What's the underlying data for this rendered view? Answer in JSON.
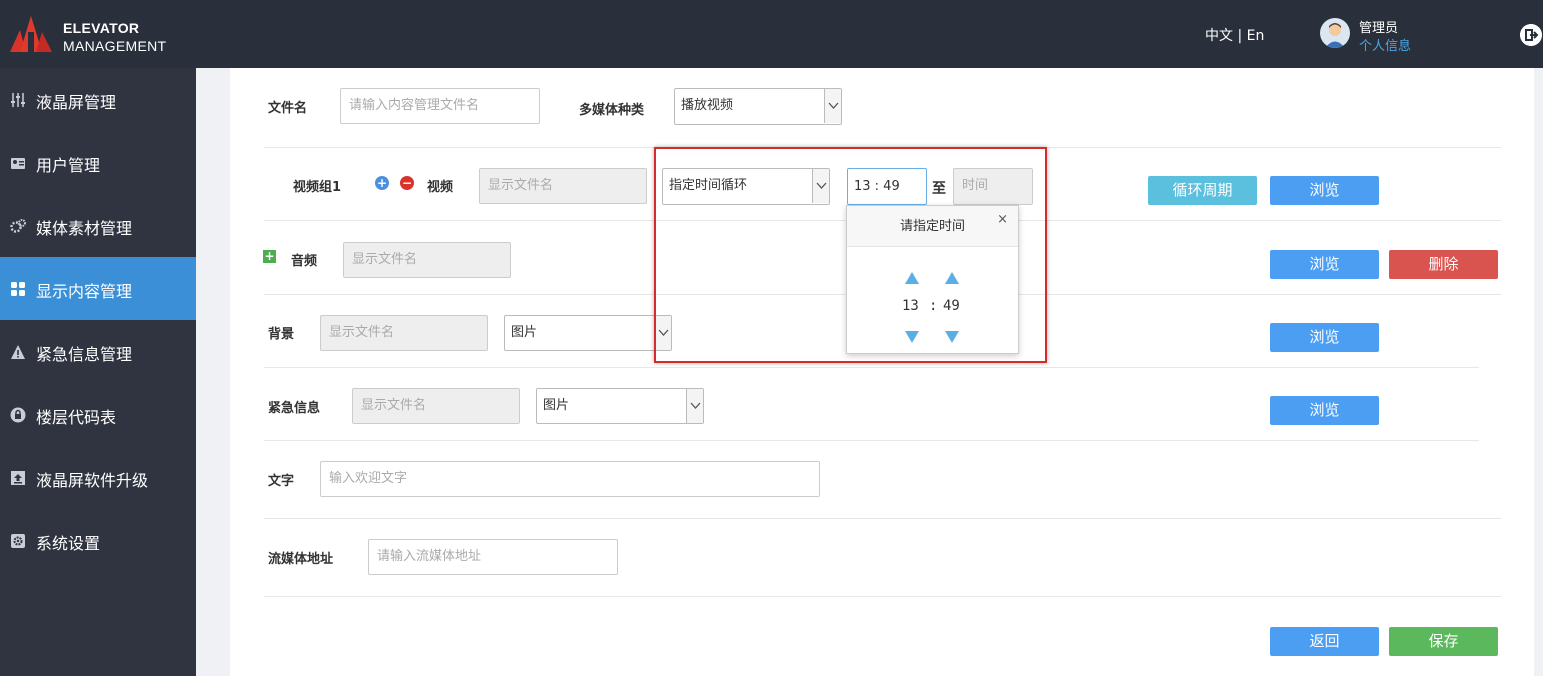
{
  "header": {
    "brand_line1": "ELEVATOR",
    "brand_line2": "MANAGEMENT",
    "language": "中文 | En",
    "user_name": "管理员",
    "user_info_link": "个人信息",
    "logo_colors": [
      "#e03a2f",
      "#c52b22"
    ]
  },
  "sidebar": {
    "items": [
      {
        "label": "液晶屏管理",
        "icon": "sliders-icon"
      },
      {
        "label": "用户管理",
        "icon": "user-card-icon"
      },
      {
        "label": "媒体素材管理",
        "icon": "gears-icon"
      },
      {
        "label": "显示内容管理",
        "icon": "grid-icon",
        "active": true
      },
      {
        "label": "紧急信息管理",
        "icon": "warning-icon"
      },
      {
        "label": "楼层代码表",
        "icon": "lock-icon"
      },
      {
        "label": "液晶屏软件升级",
        "icon": "upload-icon"
      },
      {
        "label": "系统设置",
        "icon": "gear-icon"
      }
    ]
  },
  "form": {
    "filename_label": "文件名",
    "filename_placeholder": "请输入内容管理文件名",
    "media_type_label": "多媒体种类",
    "media_type_value": "播放视频",
    "video_group_label": "视频组1",
    "video_label": "视频",
    "video_file_placeholder": "显示文件名",
    "loop_mode_value": "指定时间循环",
    "time_from": "13 : 49",
    "to_label": "至",
    "time_to_placeholder": "时间",
    "loop_period_button": "循环周期",
    "browse_button": "浏览",
    "audio_label": "音频",
    "audio_file_placeholder": "显示文件名",
    "delete_button": "删除",
    "background_label": "背景",
    "background_file_placeholder": "显示文件名",
    "background_type_value": "图片",
    "emergency_label": "紧急信息",
    "emergency_file_placeholder": "显示文件名",
    "emergency_type_value": "图片",
    "text_label": "文字",
    "text_placeholder": "输入欢迎文字",
    "stream_label": "流媒体地址",
    "stream_placeholder": "请输入流媒体地址",
    "back_button": "返回",
    "save_button": "保存"
  },
  "time_picker": {
    "title": "请指定时间",
    "close": "×",
    "hour": "13",
    "separator": ":",
    "minute": "49"
  }
}
